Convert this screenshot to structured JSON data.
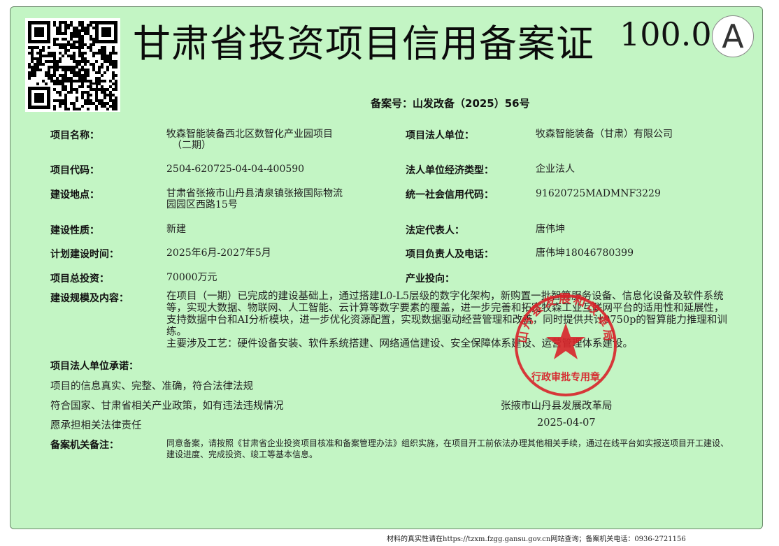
{
  "title": "甘肃省投资项目信用备案证",
  "score": "100.0",
  "grade": "A",
  "record_number": "备案号：山发改备（2025）56号",
  "fields": {
    "project_name_label": "项目名称：",
    "project_name_line1": "牧森智能装备西北区数智化产业园项目",
    "project_name_line2": "（二期）",
    "legal_entity_label": "项目法人单位：",
    "legal_entity": "牧森智能装备（甘肃）有限公司",
    "project_code_label": "项目代码：",
    "project_code": "2504-620725-04-04-400590",
    "economic_type_label": "法人单位经济类型：",
    "economic_type": "企业法人",
    "location_label": "建设地点：",
    "location_line1": "甘肃省张掖市山丹县清泉镇张掖国际物流",
    "location_line2": "园园区西路15号",
    "credit_code_label": "统一社会信用代码：",
    "credit_code": "91620725MADMNF3229",
    "nature_label": "建设性质：",
    "nature": "新建",
    "legal_rep_label": "法定代表人：",
    "legal_rep": "唐伟坤",
    "schedule_label": "计划建设时间：",
    "schedule": "2025年6月-2027年5月",
    "contact_label": "项目负责人及电话：",
    "contact": "唐伟坤18046780399",
    "investment_label": "项目总投资：",
    "investment": "70000万元",
    "industry_label": "产业投向：",
    "industry": "",
    "scope_label": "建设规模及内容：",
    "scope_text": "在项目（一期）已完成的建设基础上，通过搭建L0-L5层级的数字化架构，新购置一批智算服务设备、信息化设备及软件系统等，实现大数据、物联网、人工智能、云计算等数字要素的覆盖，进一步完善和拓宽牧森工业互联网平台的适用性和延展性，支持数据中台和AI分析模块，进一步优化资源配置，实现数据驱动经营管理和改善，同时提供共计9750p的智算能力推理和训练。",
    "scope_text2": "主要涉及工艺：硬件设备安装、软件系统搭建、网络通信建设、安全保障体系建设、运营管理体系建设。"
  },
  "commitment": {
    "label": "项目法人单位承诺：",
    "line1": "项目的信息真实、完整、准确，符合法律法规",
    "line2": "符合国家、甘肃省相关产业政策，如有违法违规情况",
    "line3": "愿承担相关法律责任"
  },
  "issuer": {
    "name": "张掖市山丹县发展改革局",
    "date": "2025-04-07"
  },
  "seal": {
    "ring_text": "山丹县发展和改革局",
    "bottom_text": "行政审批专用章",
    "color": "#d8232a"
  },
  "remark": {
    "label": "备案机关备注：",
    "text": "同意备案，请按照《甘肃省企业投资项目核准和备案管理办法》组织实施，在项目开工前依法办理其他相关手续，通过在线平台如实报送项目开工建设、建设进度、完成投资、竣工等基本信息。"
  },
  "footer": "材料的真实性请在https://tzxm.fzgg.gansu.gov.cn网站查询；备案机关电话：0936-2721156"
}
